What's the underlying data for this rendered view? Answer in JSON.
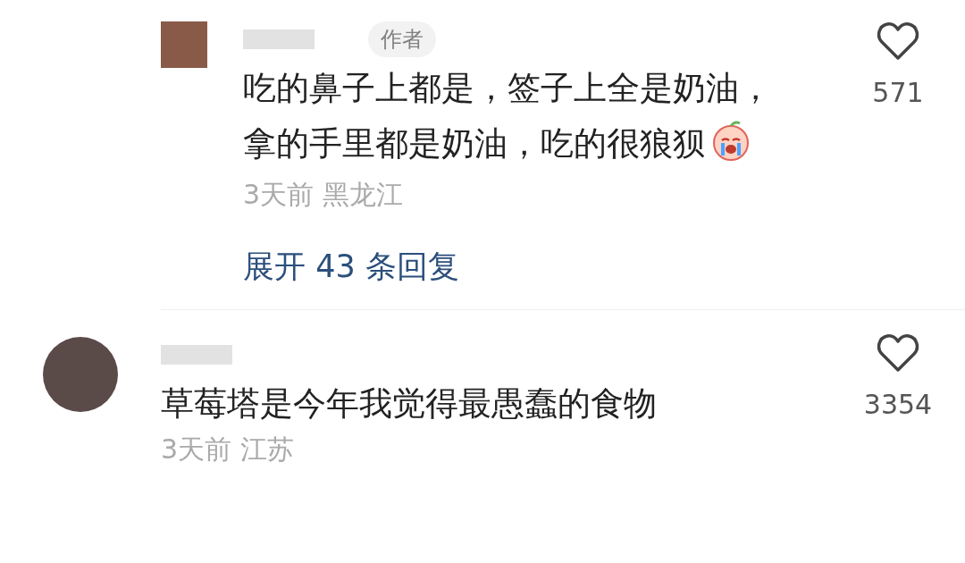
{
  "comments": [
    {
      "kind": "reply",
      "badge": "作者",
      "lines": [
        "吃的鼻子上都是，签子上全是奶油，",
        "拿的手里都是奶油，吃的很狼狈"
      ],
      "emoji": true,
      "meta": "3天前 黑龙江",
      "likes": "571",
      "liked": false,
      "expand": "展开 43 条回复"
    },
    {
      "kind": "top",
      "lines": [
        "草莓塔是今年我觉得最愚蠢的食物"
      ],
      "emoji": false,
      "meta": "3天前 江苏",
      "likes": "3354",
      "liked": false
    }
  ]
}
